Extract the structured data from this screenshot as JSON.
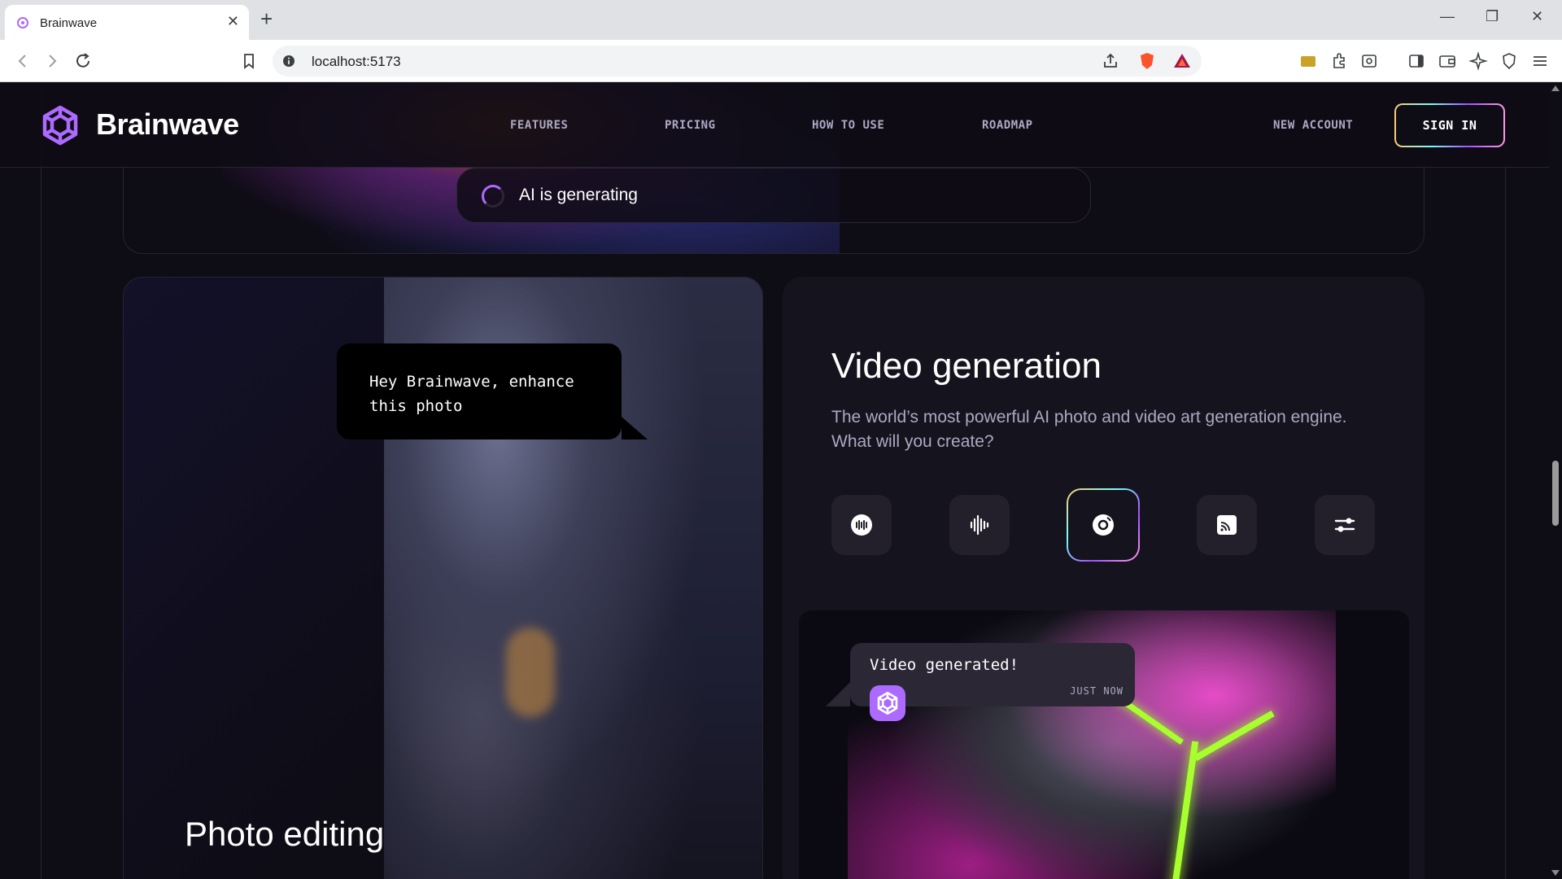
{
  "browser": {
    "tab_title": "Brainwave",
    "new_tab": "+",
    "url": "localhost:5173"
  },
  "header": {
    "brand": "Brainwave",
    "nav": [
      "FEATURES",
      "PRICING",
      "HOW TO USE",
      "ROADMAP"
    ],
    "new_account": "NEW ACCOUNT",
    "sign_in": "SIGN IN"
  },
  "generating": {
    "text": "AI is generating"
  },
  "photo_card": {
    "prompt": "Hey Brainwave, enhance this photo",
    "title": "Photo editing"
  },
  "video_card": {
    "title": "Video generation",
    "description": "The world’s most powerful AI photo and video art generation engine. What will you create?",
    "icons": [
      "record-icon",
      "waveform-icon",
      "disc-icon",
      "cast-icon",
      "sliders-icon"
    ],
    "active_icon": "disc-icon",
    "notification": {
      "text": "Video generated!",
      "time": "JUST NOW"
    }
  },
  "colors": {
    "background": "#0E0C15",
    "card": "#15131D",
    "accent": "#AC6AFF",
    "muted_text": "#ADA8C3",
    "neon": "#A8FF2E"
  }
}
